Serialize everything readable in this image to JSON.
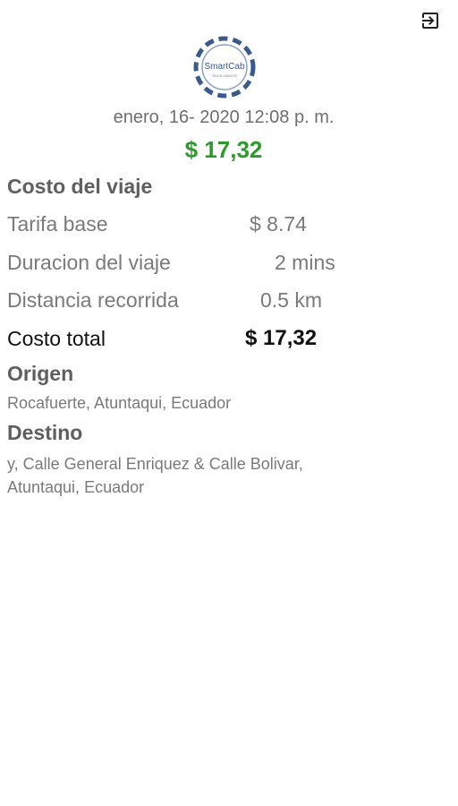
{
  "header": {
    "exit_icon": "exit-to-app-icon",
    "logo_text": "SmartCab",
    "logo_subtext": "TAXIS UNIDOS",
    "date": "enero, 16- 2020  12:08 p. m.",
    "total": "$ 17,32"
  },
  "trip_cost": {
    "title": "Costo del viaje",
    "rows": [
      {
        "label": "Tarifa base",
        "value": "$ 8.74"
      },
      {
        "label": "Duracion del viaje",
        "value": "2 mins"
      },
      {
        "label": "Distancia recorrida",
        "value": "0.5 km"
      }
    ],
    "total_label": "Costo total",
    "total_value": "$ 17,32"
  },
  "origin": {
    "title": "Origen",
    "address": "Rocafuerte, Atuntaqui, Ecuador"
  },
  "destination": {
    "title": "Destino",
    "address": "y, Calle General Enriquez & Calle Bolivar, Atuntaqui, Ecuador"
  },
  "colors": {
    "total_green": "#2e9a2e",
    "logo_blue": "#3a5a8c"
  }
}
